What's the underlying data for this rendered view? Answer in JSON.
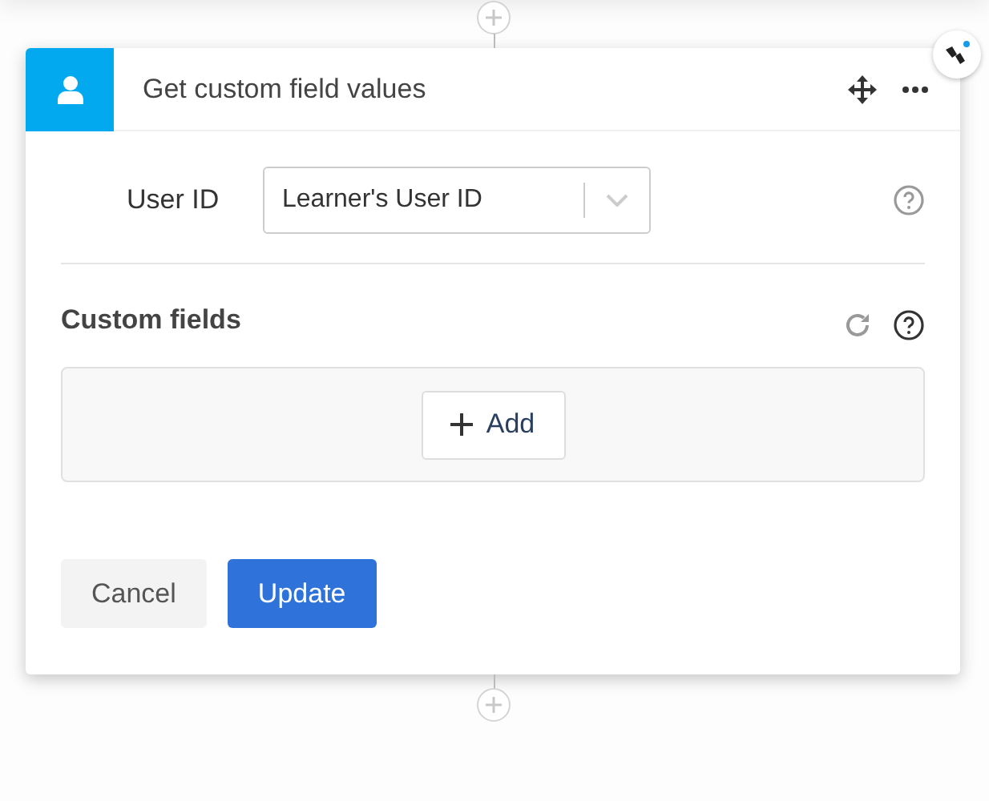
{
  "card": {
    "title": "Get custom field values"
  },
  "user_id": {
    "label": "User ID",
    "value": "Learner's User ID"
  },
  "custom_fields": {
    "title": "Custom fields",
    "add_button": "Add"
  },
  "buttons": [
    {
      "label": "Cancel",
      "kind": "secondary"
    },
    {
      "label": "Update",
      "kind": "primary"
    }
  ]
}
